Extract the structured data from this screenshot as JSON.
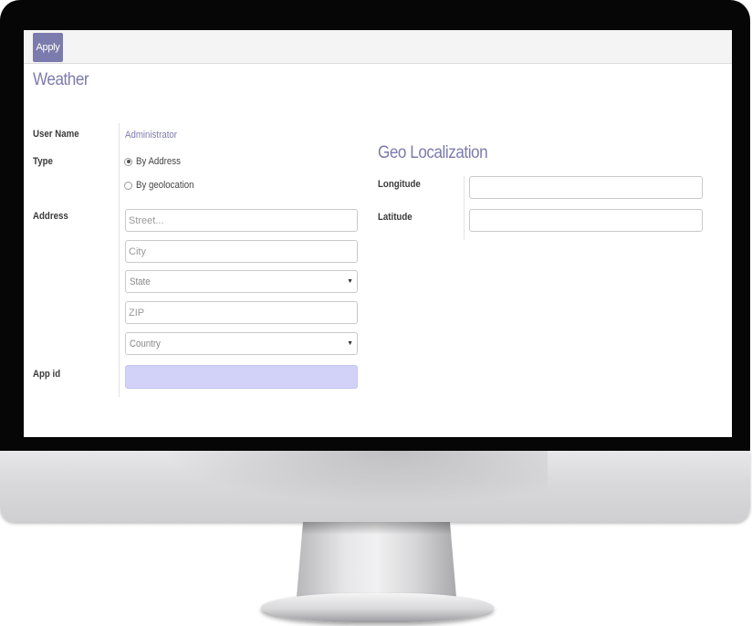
{
  "toolbar": {
    "apply_label": "Apply"
  },
  "form": {
    "title": "Weather",
    "user_name": {
      "label": "User Name",
      "value": "Administrator"
    },
    "type": {
      "label": "Type",
      "options": [
        {
          "label": "By Address",
          "selected": true
        },
        {
          "label": "By geolocation",
          "selected": false
        }
      ]
    },
    "address": {
      "label": "Address",
      "street_placeholder": "Street...",
      "city_placeholder": "City",
      "state_placeholder": "State",
      "zip_placeholder": "ZIP",
      "country_placeholder": "Country"
    },
    "app_id": {
      "label": "App id",
      "value": ""
    }
  },
  "geo": {
    "title": "Geo Localization",
    "longitude": {
      "label": "Longitude",
      "value": ""
    },
    "latitude": {
      "label": "Latitude",
      "value": ""
    }
  },
  "colors": {
    "accent": "#7c7bad",
    "required_field": "#d2d2f9",
    "bezel": "#060606"
  },
  "icons": [
    "chevron-down-icon",
    "radio-icon"
  ]
}
